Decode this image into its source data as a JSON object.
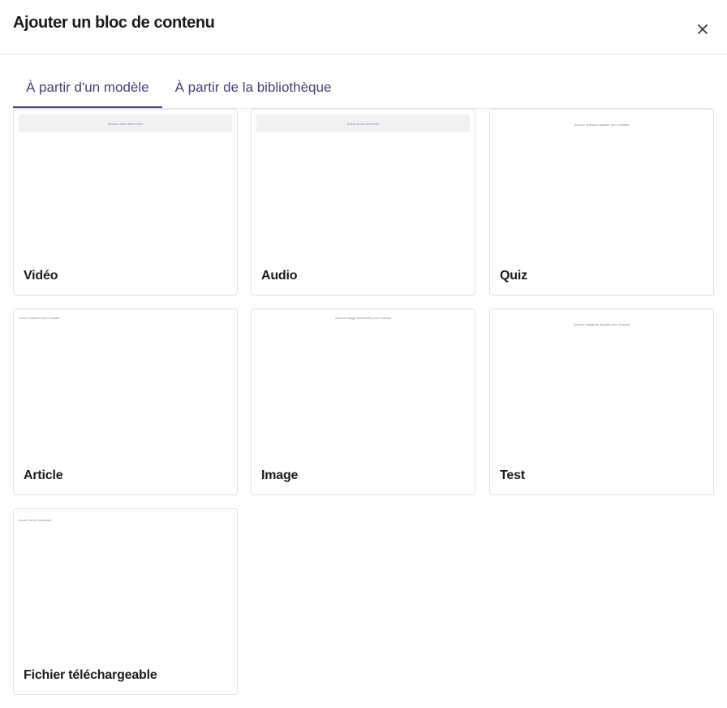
{
  "modal": {
    "title": "Ajouter un bloc de contenu",
    "close_icon": "close-icon"
  },
  "tabs": [
    {
      "label": "À partir d'un modèle",
      "active": true
    },
    {
      "label": "À partir de la bibliothèque",
      "active": false
    }
  ],
  "cards": [
    {
      "label": "Vidéo",
      "preview_text": "Aucune vidéo téléversée"
    },
    {
      "label": "Audio",
      "preview_text": "Aucun audio téléversé"
    },
    {
      "label": "Quiz",
      "preview_text": "Aucune question ajoutée pour l'instant"
    },
    {
      "label": "Article",
      "preview_text": "Aucun contenu pour l'instant"
    },
    {
      "label": "Image",
      "preview_text": "Aucune image téléversée pour l'instant"
    },
    {
      "label": "Test",
      "preview_text": "Aucune catégorie ajoutée pour l'instant"
    },
    {
      "label": "Fichier téléchargeable",
      "preview_text": "Aucun fichier téléversé"
    }
  ],
  "colors": {
    "accent": "#4b3f72",
    "border": "#e1e1e6",
    "title": "#1b1b1f"
  }
}
